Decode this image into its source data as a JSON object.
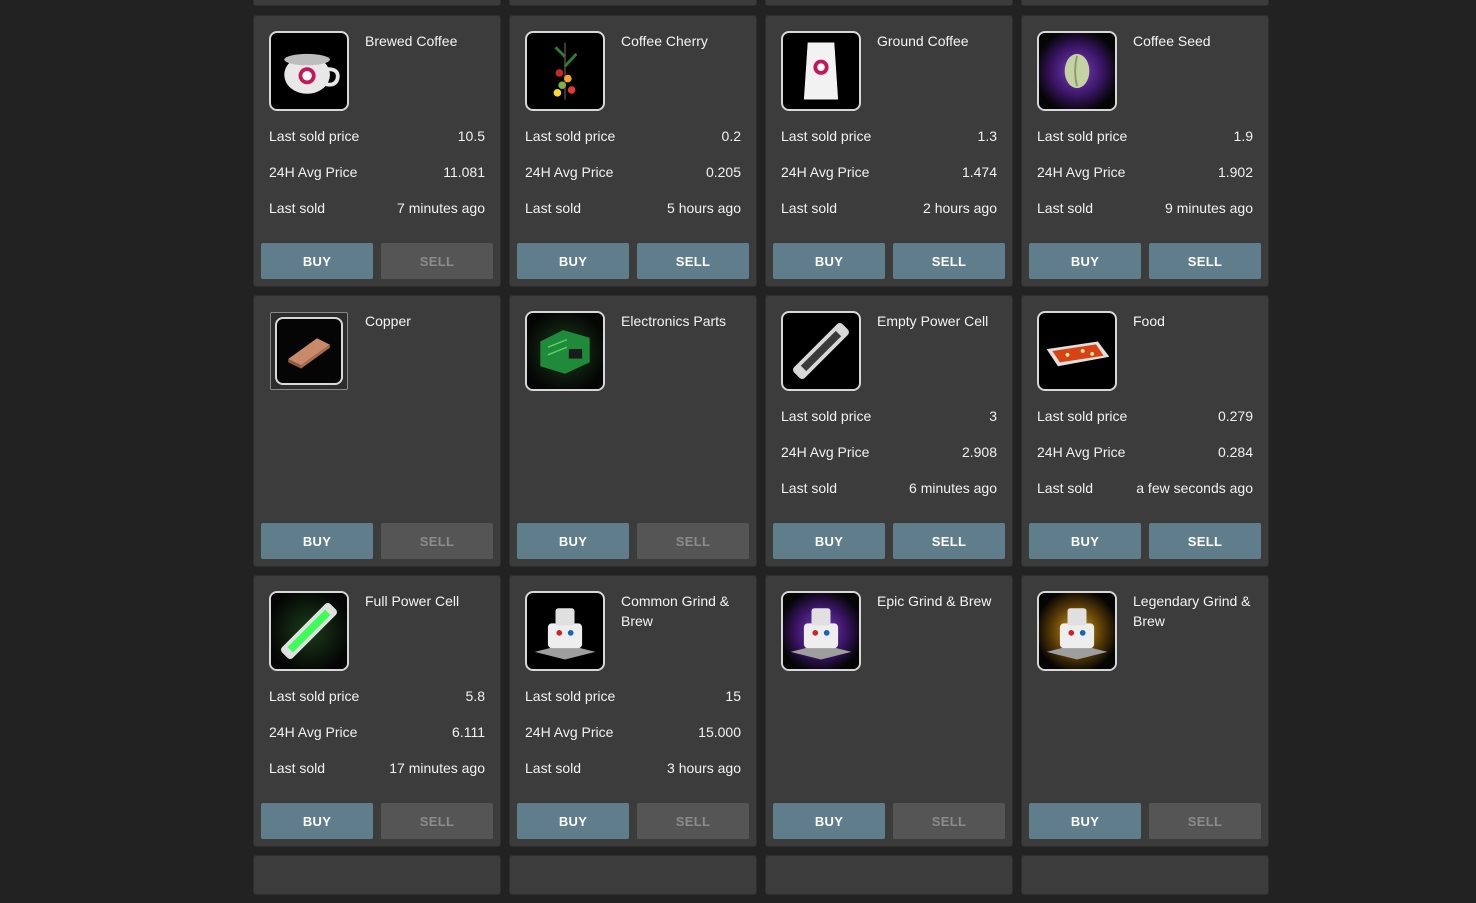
{
  "labels": {
    "last_sold_price": "Last sold price",
    "avg_price": "24H Avg Price",
    "last_sold": "Last sold",
    "buy": "BUY",
    "sell": "SELL"
  },
  "colors": {
    "accent": "#607d8b",
    "disabled": "#555555",
    "card": "#3c3c3c",
    "background": "#222222"
  },
  "items": [
    {
      "name": "Brewed Coffee",
      "icon": "coffee-mug-icon",
      "last_sold_price": "10.5",
      "avg_price": "11.081",
      "last_sold": "7 minutes ago",
      "sell_enabled": false
    },
    {
      "name": "Coffee Cherry",
      "icon": "coffee-cherry-icon",
      "last_sold_price": "0.2",
      "avg_price": "0.205",
      "last_sold": "5 hours ago",
      "sell_enabled": true
    },
    {
      "name": "Ground Coffee",
      "icon": "coffee-bag-icon",
      "last_sold_price": "1.3",
      "avg_price": "1.474",
      "last_sold": "2 hours ago",
      "sell_enabled": true
    },
    {
      "name": "Coffee Seed",
      "icon": "coffee-seed-icon",
      "last_sold_price": "1.9",
      "avg_price": "1.902",
      "last_sold": "9 minutes ago",
      "sell_enabled": true
    },
    {
      "name": "Copper",
      "icon": "copper-ingot-icon",
      "sell_enabled": false
    },
    {
      "name": "Electronics Parts",
      "icon": "circuit-board-icon",
      "sell_enabled": false
    },
    {
      "name": "Empty Power Cell",
      "icon": "empty-power-cell-icon",
      "last_sold_price": "3",
      "avg_price": "2.908",
      "last_sold": "6 minutes ago",
      "sell_enabled": true
    },
    {
      "name": "Food",
      "icon": "food-tray-icon",
      "last_sold_price": "0.279",
      "avg_price": "0.284",
      "last_sold": "a few seconds ago",
      "sell_enabled": true
    },
    {
      "name": "Full Power Cell",
      "icon": "full-power-cell-icon",
      "last_sold_price": "5.8",
      "avg_price": "6.111",
      "last_sold": "17 minutes ago",
      "sell_enabled": false
    },
    {
      "name": "Common Grind & Brew",
      "icon": "grind-brew-machine-icon",
      "last_sold_price": "15",
      "avg_price": "15.000",
      "last_sold": "3 hours ago",
      "sell_enabled": false
    },
    {
      "name": "Epic Grind & Brew",
      "icon": "epic-grind-brew-machine-icon",
      "sell_enabled": false
    },
    {
      "name": "Legendary Grind & Brew",
      "icon": "legendary-grind-brew-machine-icon",
      "sell_enabled": false
    }
  ]
}
